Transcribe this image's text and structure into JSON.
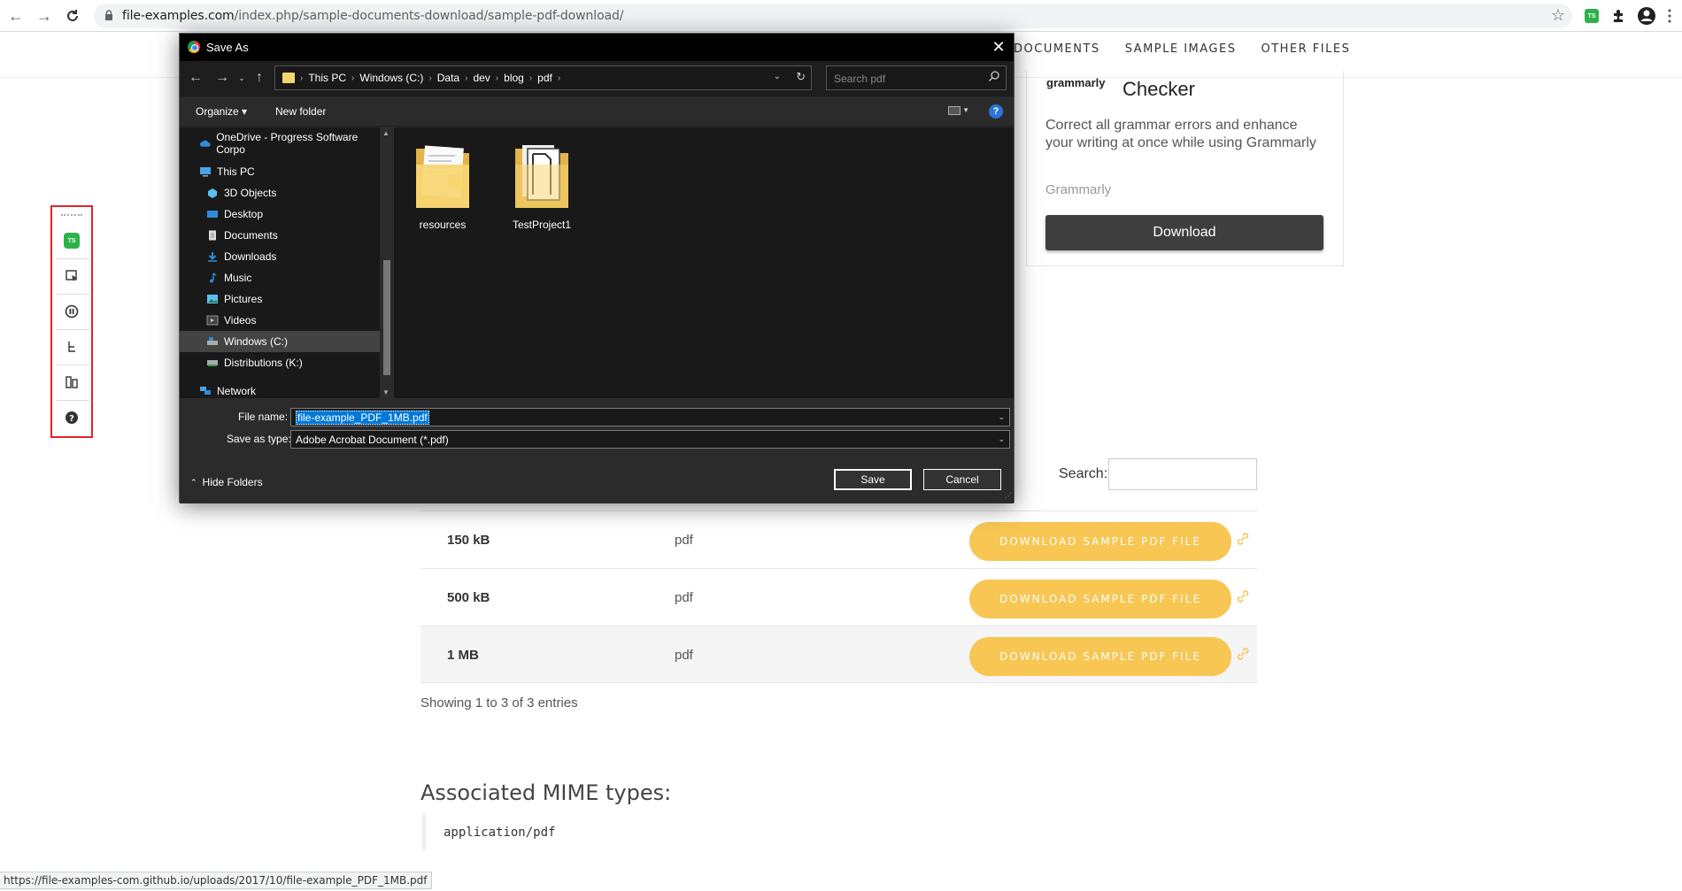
{
  "browser": {
    "url_host": "file-examples.com",
    "url_path": "/index.php/sample-documents-download/sample-pdf-download/",
    "ext_badge": "TS"
  },
  "site_nav": {
    "items": [
      "DOCUMENTS",
      "SAMPLE IMAGES",
      "OTHER FILES"
    ]
  },
  "ad": {
    "brand": "grammarly",
    "title": "Checker",
    "text": "Correct all grammar errors and enhance your writing at once while using Grammarly",
    "source": "Grammarly",
    "button": "Download"
  },
  "table": {
    "search_label": "Search:",
    "search_value": "",
    "rows": [
      {
        "size": "150 kB",
        "format": "pdf",
        "button": "DOWNLOAD SAMPLE PDF FILE"
      },
      {
        "size": "500 kB",
        "format": "pdf",
        "button": "DOWNLOAD SAMPLE PDF FILE"
      },
      {
        "size": "1 MB",
        "format": "pdf",
        "button": "DOWNLOAD SAMPLE PDF FILE"
      }
    ],
    "showing": "Showing 1 to 3 of 3 entries"
  },
  "mime": {
    "title": "Associated MIME types:",
    "code": "application/pdf"
  },
  "status_bar": "https://file-examples-com.github.io/uploads/2017/10/file-example_PDF_1MB.pdf",
  "side_toolbar": {
    "badge": "TS",
    "icons": [
      "ts-recorder-icon",
      "select-element-icon",
      "pause-icon",
      "tree-icon",
      "split-panel-icon",
      "help-icon"
    ]
  },
  "dialog": {
    "title": "Save As",
    "breadcrumbs": [
      "This PC",
      "Windows (C:)",
      "Data",
      "dev",
      "blog",
      "pdf"
    ],
    "search_placeholder": "Search pdf",
    "organize": "Organize",
    "new_folder": "New folder",
    "tree": [
      {
        "label": "OneDrive - Progress Software Corpo",
        "icon": "onedrive-icon",
        "indent": 0
      },
      {
        "label": "This PC",
        "icon": "pc-icon",
        "indent": 0
      },
      {
        "label": "3D Objects",
        "icon": "3d-objects-icon",
        "indent": 1
      },
      {
        "label": "Desktop",
        "icon": "desktop-icon",
        "indent": 1
      },
      {
        "label": "Documents",
        "icon": "documents-icon",
        "indent": 1
      },
      {
        "label": "Downloads",
        "icon": "downloads-icon",
        "indent": 1
      },
      {
        "label": "Music",
        "icon": "music-icon",
        "indent": 1
      },
      {
        "label": "Pictures",
        "icon": "pictures-icon",
        "indent": 1
      },
      {
        "label": "Videos",
        "icon": "videos-icon",
        "indent": 1
      },
      {
        "label": "Windows (C:)",
        "icon": "drive-c-icon",
        "indent": 1,
        "selected": true
      },
      {
        "label": "Distributions (K:)",
        "icon": "drive-k-icon",
        "indent": 1
      },
      {
        "label": "Network",
        "icon": "network-icon",
        "indent": 0
      }
    ],
    "files": [
      "resources",
      "TestProject1"
    ],
    "file_name_label": "File name:",
    "file_name_value": "file-example_PDF_1MB.pdf",
    "save_type_label": "Save as type:",
    "save_type_value": "Adobe Acrobat Document (*.pdf)",
    "save_button": "Save",
    "cancel_button": "Cancel",
    "hide_folders": "Hide Folders"
  },
  "colors": {
    "download_button": "#f7c653",
    "ad_button": "#3e3e3e",
    "toolbar_border": "#e0242b",
    "selection": "#0078d7"
  }
}
